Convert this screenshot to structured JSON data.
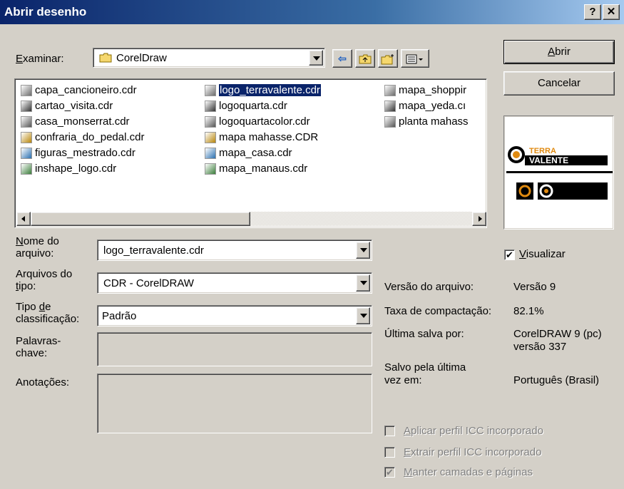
{
  "window": {
    "title": "Abrir desenho",
    "help_label": "?",
    "close_label": "✕"
  },
  "look_in": {
    "label_prefix": "E",
    "label_rest": "xaminar:",
    "value": "CorelDraw"
  },
  "files": [
    {
      "name": "capa_cancioneiro.cdr",
      "icon": "cdr-file-icon",
      "selected": false
    },
    {
      "name": "cartao_visita.cdr",
      "icon": "cdr-file-icon",
      "selected": false
    },
    {
      "name": "casa_monserrat.cdr",
      "icon": "cdr-file-icon",
      "selected": false
    },
    {
      "name": "confraria_do_pedal.cdr",
      "icon": "cdr-file-icon",
      "selected": false
    },
    {
      "name": "figuras_mestrado.cdr",
      "icon": "cdr-file-icon",
      "selected": false
    },
    {
      "name": "inshape_logo.cdr",
      "icon": "cdr-file-icon",
      "selected": false
    },
    {
      "name": "logo_terravalente.cdr",
      "icon": "cdr-file-icon",
      "selected": true
    },
    {
      "name": "logoquarta.cdr",
      "icon": "cdr-file-icon",
      "selected": false
    },
    {
      "name": "logoquartacolor.cdr",
      "icon": "cdr-file-icon",
      "selected": false
    },
    {
      "name": "mapa mahasse.CDR",
      "icon": "cdr-file-icon",
      "selected": false
    },
    {
      "name": "mapa_casa.cdr",
      "icon": "cdr-file-icon",
      "selected": false
    },
    {
      "name": "mapa_manaus.cdr",
      "icon": "cdr-file-icon",
      "selected": false
    },
    {
      "name": "mapa_shoppir",
      "icon": "cdr-file-icon",
      "selected": false
    },
    {
      "name": "mapa_yeda.cı",
      "icon": "cdr-file-icon",
      "selected": false
    },
    {
      "name": "planta mahass",
      "icon": "cdr-file-icon",
      "selected": false
    }
  ],
  "fields": {
    "filename_label_u": "N",
    "filename_label_rest1": "ome do",
    "filename_label_rest2": "arquivo:",
    "filename_value": "logo_terravalente.cdr",
    "filetype_label1": "Arquivos do",
    "filetype_label2_u": "t",
    "filetype_label2_rest": "ipo:",
    "filetype_value": "CDR - CorelDRAW",
    "sort_label1_a": "Tipo ",
    "sort_label1_u": "d",
    "sort_label1_b": "e",
    "sort_label2": "classificação:",
    "sort_value": "Padrão",
    "keywords_label1": "Palavras-",
    "keywords_label2": "chave:",
    "keywords_value": "",
    "notes_label": "Anotações:",
    "notes_value": ""
  },
  "buttons": {
    "open_u": "A",
    "open_rest": "brir",
    "cancel": "Cancelar"
  },
  "preview": {
    "checkbox_u": "V",
    "checkbox_rest": "isualizar",
    "checked": true,
    "logo_text_top1": "TERRA",
    "logo_text_top2": "VALENTE",
    "logo_text_bottom": "TERRA VALENTE"
  },
  "file_info": {
    "version_label": "Versão do arquivo:",
    "version_value": "Versão 9",
    "compression_label": "Taxa de compactação:",
    "compression_value": "82.1%",
    "saved_by_label": "Última salva por:",
    "saved_by_value1": "CorelDRAW 9 (pc)",
    "saved_by_value2": "versão 337",
    "language_label1": "Salvo pela última",
    "language_label2": "vez em:",
    "language_value": "Português (Brasil)"
  },
  "options": [
    {
      "u": "A",
      "rest": "plicar perfil ICC incorporado",
      "checked": false
    },
    {
      "u": "E",
      "rest": "xtrair perfil ICC incorporado",
      "checked": false
    },
    {
      "u": "M",
      "rest": "anter camadas e páginas",
      "checked": true
    }
  ],
  "colors": {
    "title_start": "#0a246a",
    "title_end": "#a6caf0",
    "face": "#d4d0c8",
    "selection": "#0a246a"
  }
}
